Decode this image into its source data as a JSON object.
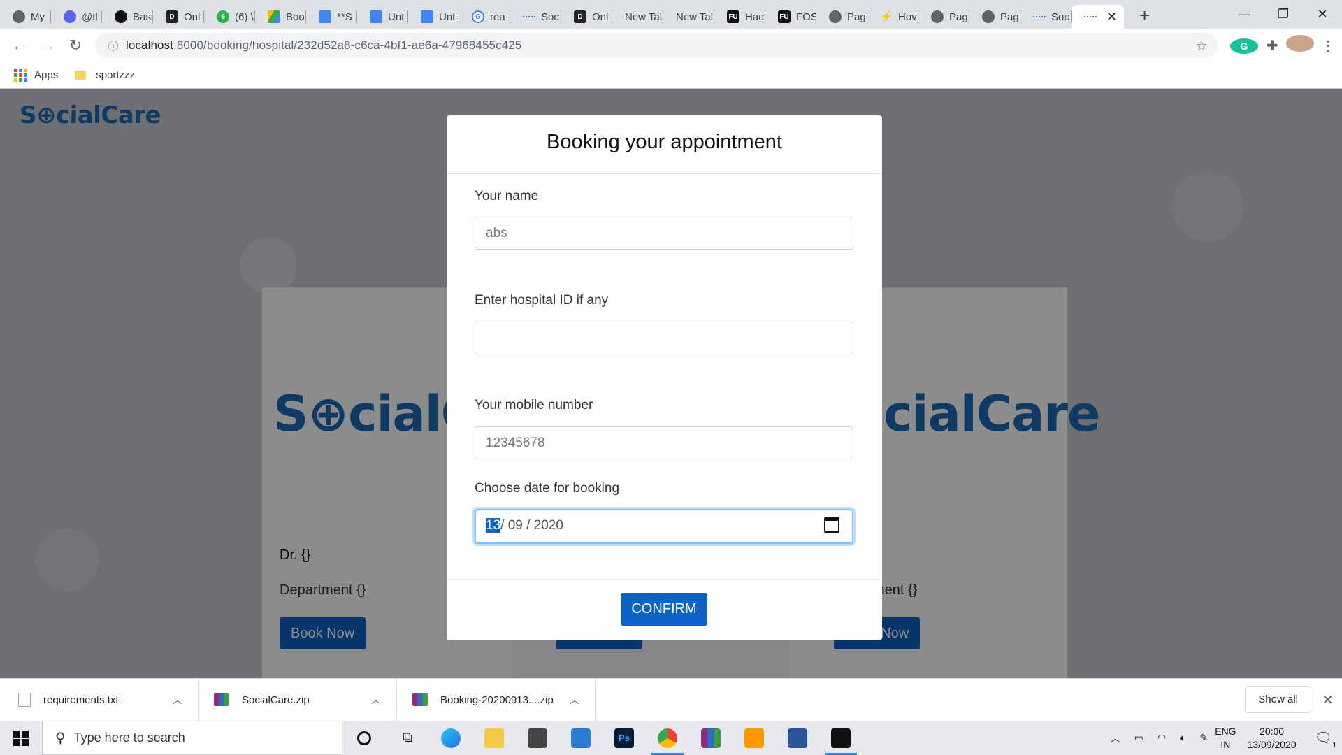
{
  "browser": {
    "tabs": [
      {
        "label": "My",
        "icon": "globe-icon"
      },
      {
        "label": "@tl",
        "icon": "discord-icon"
      },
      {
        "label": "Basi",
        "icon": "github-icon"
      },
      {
        "label": "Onl",
        "icon": "d-icon"
      },
      {
        "label": "(6) \\",
        "icon": "green-icon"
      },
      {
        "label": "Boo",
        "icon": "drive-icon"
      },
      {
        "label": "**S",
        "icon": "docs-icon"
      },
      {
        "label": "Unt",
        "icon": "docs-icon"
      },
      {
        "label": "Unt",
        "icon": "docs-icon"
      },
      {
        "label": "rea",
        "icon": "google-icon"
      },
      {
        "label": "Soc",
        "icon": "dash-icon"
      },
      {
        "label": "Onl",
        "icon": "d-icon"
      },
      {
        "label": "New Tal",
        "icon": "none"
      },
      {
        "label": "New Tal",
        "icon": "none"
      },
      {
        "label": "Hac",
        "icon": "fu-icon"
      },
      {
        "label": "FOS",
        "icon": "fu-icon"
      },
      {
        "label": "Pag",
        "icon": "globe-icon"
      },
      {
        "label": "Hov",
        "icon": "flash-icon"
      },
      {
        "label": "Pag",
        "icon": "globe-icon"
      },
      {
        "label": "Pag",
        "icon": "globe-icon"
      },
      {
        "label": "Soc",
        "icon": "dash-icon"
      }
    ],
    "active_tab_close": "✕",
    "new_tab": "+",
    "url_host": "localhost",
    "url_path": ":8000/booking/hospital/232d52a8-c6ca-4bf1-ae6a-47968455c425",
    "bookmarks": [
      {
        "label": "Apps"
      },
      {
        "label": "sportzzz"
      }
    ]
  },
  "site": {
    "logo": "S⊕cialCare",
    "card_logo_left": "S⊕cialCa",
    "card_logo_right": "cialCare",
    "card_doctor": "Dr. {}",
    "card_department": "Department {}",
    "card_department_partial": "ment {}",
    "book_now": "Book Now"
  },
  "modal": {
    "title": "Booking your appointment",
    "name_label": "Your name",
    "name_value": "abs",
    "hospital_label": "Enter hospital ID if any",
    "hospital_value": "",
    "mobile_label": "Your mobile number",
    "mobile_value": "12345678",
    "date_label": "Choose date for booking",
    "date_day": "13",
    "date_rest": "/ 09 / 2020",
    "confirm": "CONFIRM"
  },
  "downloads": {
    "items": [
      {
        "name": "requirements.txt"
      },
      {
        "name": "SocialCare.zip"
      },
      {
        "name": "Booking-20200913....zip"
      }
    ],
    "show_all": "Show all"
  },
  "taskbar": {
    "search_placeholder": "Type here to search",
    "lang_top": "ENG",
    "lang_bottom": "IN",
    "time": "20:00",
    "date": "13/09/2020",
    "notification_count": "1"
  },
  "colors": {
    "brand": "#1a6ab5",
    "primary_button": "#0b63c4"
  }
}
